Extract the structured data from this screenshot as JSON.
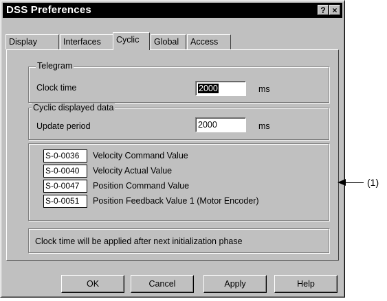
{
  "window": {
    "title": "DSS Preferences",
    "help_btn": "?",
    "close_btn": "×"
  },
  "tabs": [
    {
      "label": "Display",
      "active": false
    },
    {
      "label": "Interfaces",
      "active": false
    },
    {
      "label": "Cyclic",
      "active": true
    },
    {
      "label": "Global",
      "active": false
    },
    {
      "label": "Access",
      "active": false
    }
  ],
  "telegram": {
    "legend": "Telegram",
    "clock_label": "Clock time",
    "clock_value": "2000",
    "clock_unit": "ms"
  },
  "cyclic_display": {
    "legend": "Cyclic displayed data",
    "update_label": "Update period",
    "update_value": "2000",
    "update_unit": "ms"
  },
  "params": [
    {
      "id": "S-0-0036",
      "name": "Velocity Command Value"
    },
    {
      "id": "S-0-0040",
      "name": "Velocity Actual Value"
    },
    {
      "id": "S-0-0047",
      "name": "Position Command Value"
    },
    {
      "id": "S-0-0051",
      "name": "Position Feedback Value 1 (Motor Encoder)"
    }
  ],
  "info": "Clock time will be applied after next initialization phase",
  "buttons": {
    "ok": "OK",
    "cancel": "Cancel",
    "apply": "Apply",
    "help": "Help"
  },
  "annotation": "(1)"
}
